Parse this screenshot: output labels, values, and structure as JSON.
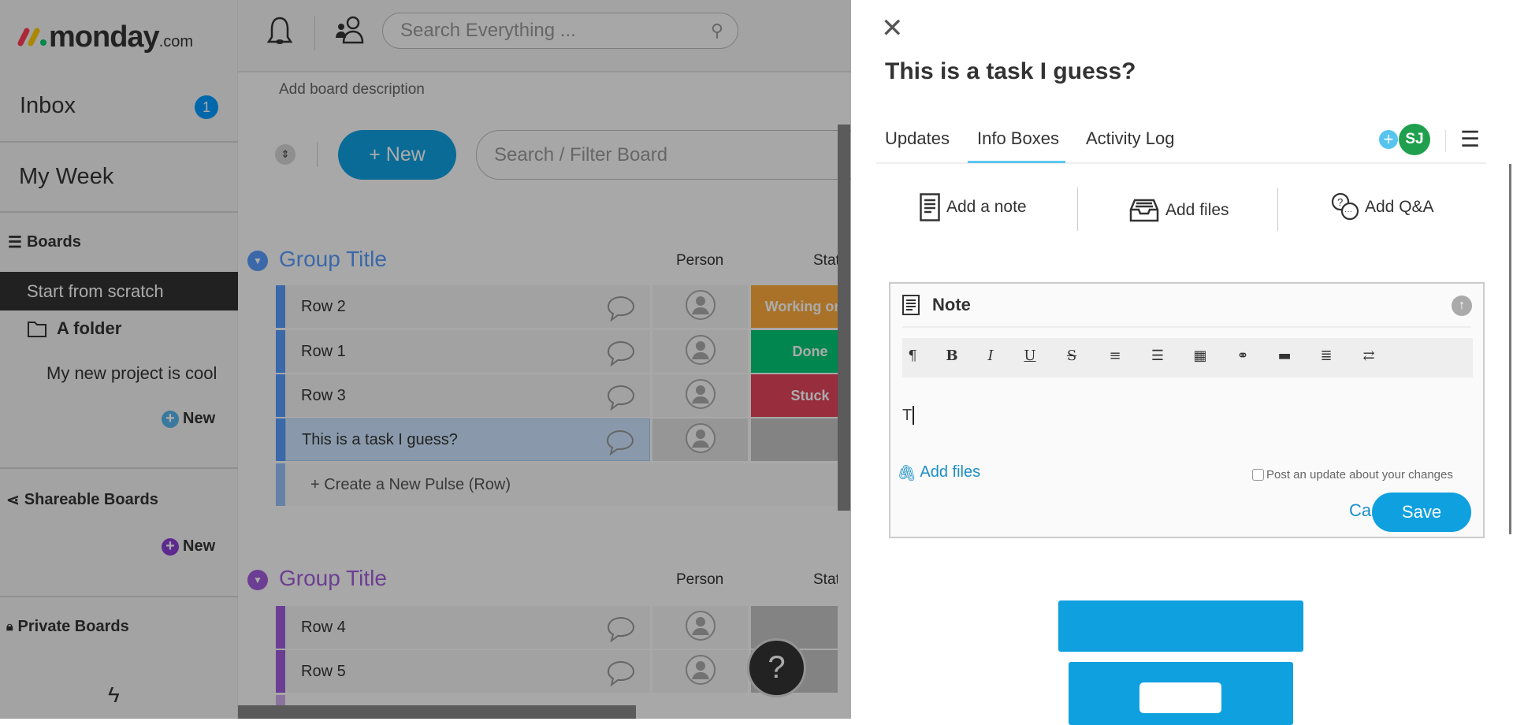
{
  "app": {
    "logo": "monday.com",
    "logo_main": "monday",
    "logo_suffix": ".com"
  },
  "topbar": {
    "search_placeholder": "Search Everything ..."
  },
  "sidebar": {
    "inbox": "Inbox",
    "inbox_count": "1",
    "my_week": "My Week",
    "boards": "Boards",
    "start_from_scratch": "Start from scratch",
    "folder": "A folder",
    "project": "My new project is cool",
    "new_label": "New",
    "shareable": "Shareable Boards",
    "private": "Private Boards"
  },
  "board": {
    "description": "Add board description",
    "new_button": "+ New",
    "filter_placeholder": "Search / Filter Board",
    "groups": [
      {
        "title": "Group Title",
        "color": "#579bfc",
        "col_person": "Person",
        "col_status": "Status",
        "rows": [
          {
            "name": "Row 2",
            "status": "Working on it",
            "status_color": "#fdab3d"
          },
          {
            "name": "Row 1",
            "status": "Done",
            "status_color": "#00c875"
          },
          {
            "name": "Row 3",
            "status": "Stuck",
            "status_color": "#e2445c"
          },
          {
            "name": "This is a task I guess?",
            "status": "",
            "selected": true
          }
        ],
        "create_row": "+ Create a New Pulse (Row)"
      },
      {
        "title": "Group Title",
        "color": "#a25ddc",
        "col_person": "Person",
        "col_status": "Status",
        "rows": [
          {
            "name": "Row 4",
            "status": ""
          },
          {
            "name": "Row 5",
            "status": ""
          }
        ]
      }
    ],
    "help": "?"
  },
  "panel": {
    "title": "This is a task I guess?",
    "tabs": [
      {
        "label": "Updates"
      },
      {
        "label": "Info Boxes",
        "active": true
      },
      {
        "label": "Activity Log"
      }
    ],
    "avatar": "SJ",
    "avatar_color": "#20a04e",
    "actions": [
      {
        "label": "Add a note",
        "icon": "note-icon"
      },
      {
        "label": "Add files",
        "icon": "inbox-tray-icon"
      },
      {
        "label": "Add Q&A",
        "icon": "qa-bubbles-icon"
      }
    ],
    "note": {
      "title": "Note",
      "content": "T",
      "add_files": "Add files",
      "post_update_label": "Post an update about your changes",
      "post_update_checked": false,
      "cancel": "Cancel",
      "save": "Save",
      "toolbar": [
        {
          "glyph": "¶",
          "icon": "paragraph-icon"
        },
        {
          "glyph": "B",
          "icon": "bold-icon"
        },
        {
          "glyph": "I",
          "icon": "italic-icon"
        },
        {
          "glyph": "U",
          "icon": "underline-icon"
        },
        {
          "glyph": "S",
          "icon": "strikethrough-icon"
        },
        {
          "glyph": "≡",
          "icon": "ordered-list-icon"
        },
        {
          "glyph": "☰",
          "icon": "bullet-list-icon"
        },
        {
          "glyph": "▦",
          "icon": "table-icon"
        },
        {
          "glyph": "⚭",
          "icon": "link-icon"
        },
        {
          "glyph": "▬",
          "icon": "horizontal-rule-icon"
        },
        {
          "glyph": "≣",
          "icon": "align-icon"
        },
        {
          "glyph": "⇄",
          "icon": "direction-icon"
        }
      ]
    },
    "accent": "#0fa0e0"
  }
}
